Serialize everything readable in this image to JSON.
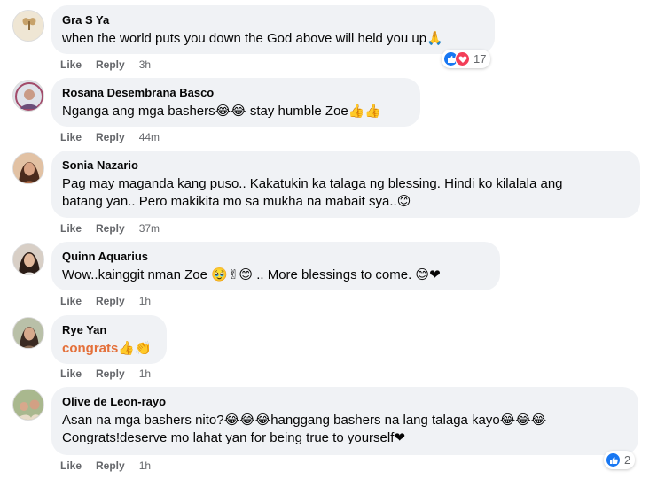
{
  "actions": {
    "like": "Like",
    "reply": "Reply"
  },
  "comments": [
    {
      "author": "Gra S Ya",
      "text": "when the world puts you down the God above will held you up🙏",
      "time": "3h",
      "reactions": {
        "icons": [
          "like-icon",
          "love-icon"
        ],
        "count": "17"
      }
    },
    {
      "author": "Rosana Desembrana Basco",
      "text": "Nganga ang mga bashers😂😂 stay humble Zoe👍👍",
      "time": "44m"
    },
    {
      "author": "Sonia Nazario",
      "text_line1": "Pag may maganda kang puso.. Kakatukin ka talaga ng blessing. Hindi ko kilalala ang",
      "text_line2": "batang yan.. Pero makikita mo sa mukha na mabait sya..😊",
      "time": "37m"
    },
    {
      "author": "Quinn Aquarius",
      "text": "Wow..kainggit nman Zoe 🥹✌😊 .. More blessings to come. 😊❤",
      "time": "1h"
    },
    {
      "author": "Rye Yan",
      "text": "congrats👍👏",
      "time": "1h"
    },
    {
      "author": "Olive de Leon-rayo",
      "text_line1": "Asan na mga bashers nito?😂😂😂hanggang bashers na lang talaga kayo😂😂😂",
      "text_line2": "Congrats!deserve mo lahat yan for being true to yourself❤",
      "time": "1h",
      "reactions": {
        "icons": [
          "like-icon"
        ],
        "count": "2"
      }
    }
  ],
  "colors": {
    "bubble": "#f0f2f5",
    "meta": "#65676b",
    "highlight": "#e4703a",
    "like": "#1877f2",
    "love": "#f33e58"
  }
}
